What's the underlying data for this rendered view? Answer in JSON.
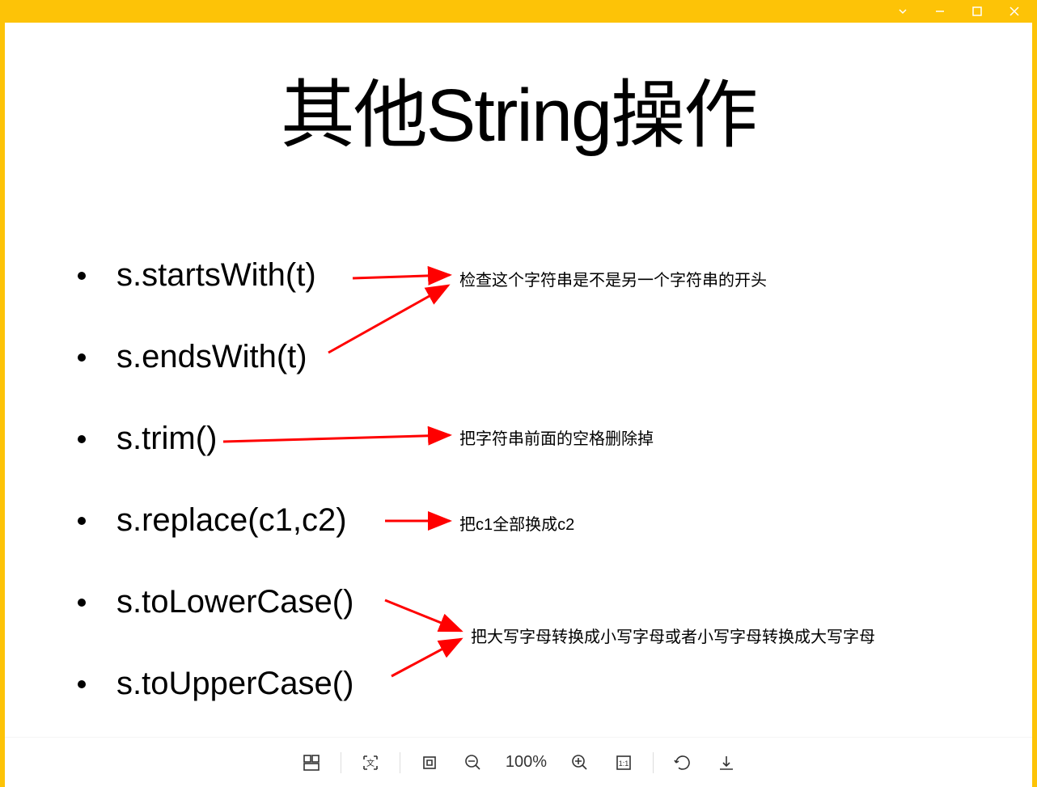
{
  "window": {
    "app_color": "#fdc307"
  },
  "slide": {
    "title": "其他String操作",
    "bullets": [
      "s.startsWith(t)",
      "s.endsWith(t)",
      "s.trim()",
      "s.replace(c1,c2)",
      "s.toLowerCase()",
      "s.toUpperCase()"
    ],
    "annotations": {
      "starts_ends": "检查这个字符串是不是另一个字符串的开头",
      "trim": "把字符串前面的空格删除掉",
      "replace": "把c1全部换成c2",
      "case": "把大写字母转换成小写字母或者小写字母转换成大写字母"
    },
    "arrow_color": "#ff0000"
  },
  "toolbar": {
    "zoom_label": "100%"
  }
}
